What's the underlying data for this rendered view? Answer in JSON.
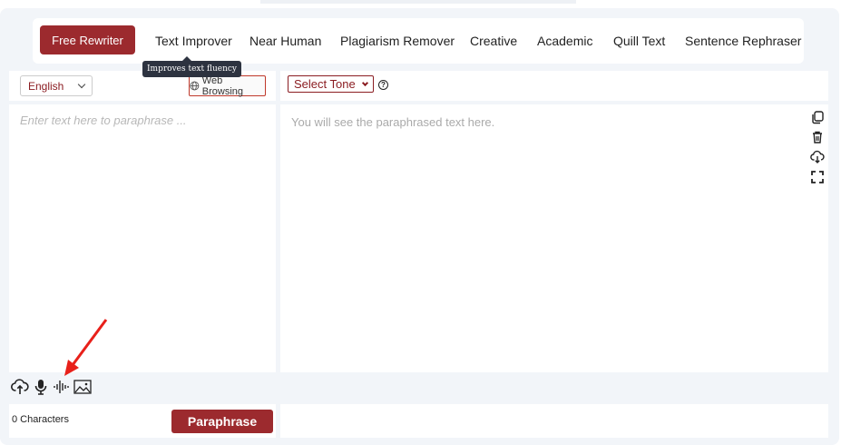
{
  "modes": {
    "active": "Free Rewriter",
    "items": [
      "Text Improver",
      "Near Human",
      "Plagiarism Remover",
      "Creative",
      "Academic",
      "Quill Text",
      "Sentence Rephraser"
    ],
    "tooltip": "Improves text fluency"
  },
  "left_toolbar": {
    "language": "English",
    "web_browsing": "Web Browsing"
  },
  "right_toolbar": {
    "tone": "Select Tone",
    "help": "?"
  },
  "input": {
    "placeholder": "Enter text here to paraphrase ...",
    "value": ""
  },
  "output": {
    "placeholder": "You will see the paraphrased text here.",
    "icons": [
      "copy-icon",
      "trash-icon",
      "cloud-download-icon",
      "fullscreen-icon"
    ]
  },
  "input_tools": [
    "cloud-upload-icon",
    "microphone-icon",
    "audio-wave-icon",
    "image-icon"
  ],
  "footer": {
    "char_count": "0 Characters",
    "paraphrase_label": "Paraphrase"
  },
  "colors": {
    "accent": "#9c2a2e",
    "annotation_arrow": "#e8201a"
  }
}
